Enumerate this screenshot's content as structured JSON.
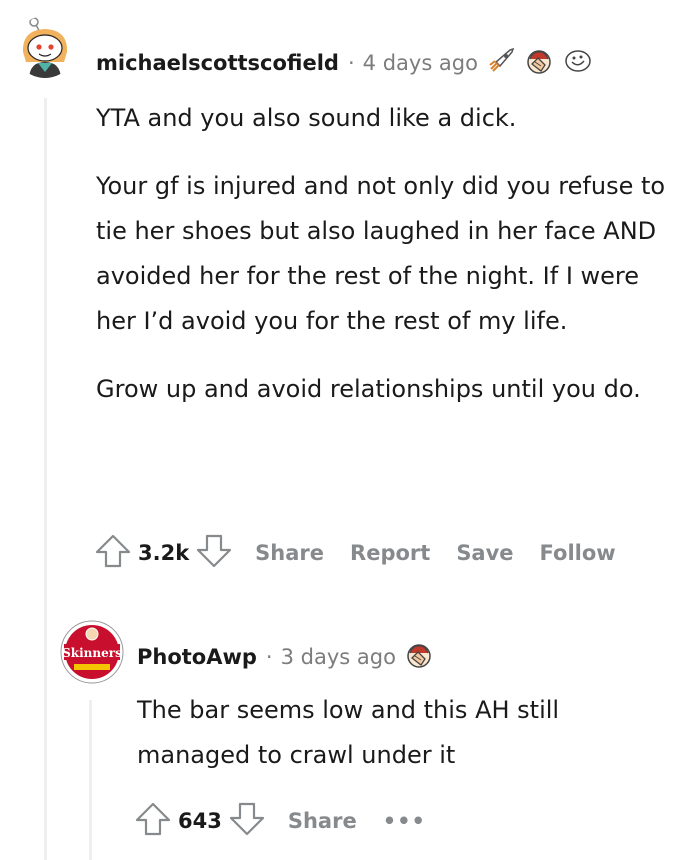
{
  "comments": [
    {
      "username": "michaelscottscofield",
      "time": "4 days ago",
      "awards": [
        "rocket-award-icon",
        "facepalm-award-icon",
        "smile-award-icon"
      ],
      "paragraphs": [
        "YTA and you also sound like a dick.",
        "Your gf is injured and not only did you refuse to tie her shoes but also laughed in her face AND avoided her for the rest of the night. If I were her I’d avoid you for the rest of my life.",
        "Grow up and avoid relationships until you do."
      ],
      "score": "3.2k",
      "actions": {
        "share": "Share",
        "report": "Report",
        "save": "Save",
        "follow": "Follow"
      }
    },
    {
      "username": "PhotoAwp",
      "time": "3 days ago",
      "awards": [
        "facepalm-award-icon"
      ],
      "avatar_text": "Skinners",
      "paragraphs": [
        "The bar seems low and this AH still managed to crawl under it"
      ],
      "score": "643",
      "actions": {
        "share": "Share",
        "more": "•••"
      }
    }
  ],
  "colors": {
    "meta_gray": "#7c7c7c",
    "action_gray": "#878a8c",
    "thread_line": "#edeff1",
    "text": "#1a1a1b"
  }
}
